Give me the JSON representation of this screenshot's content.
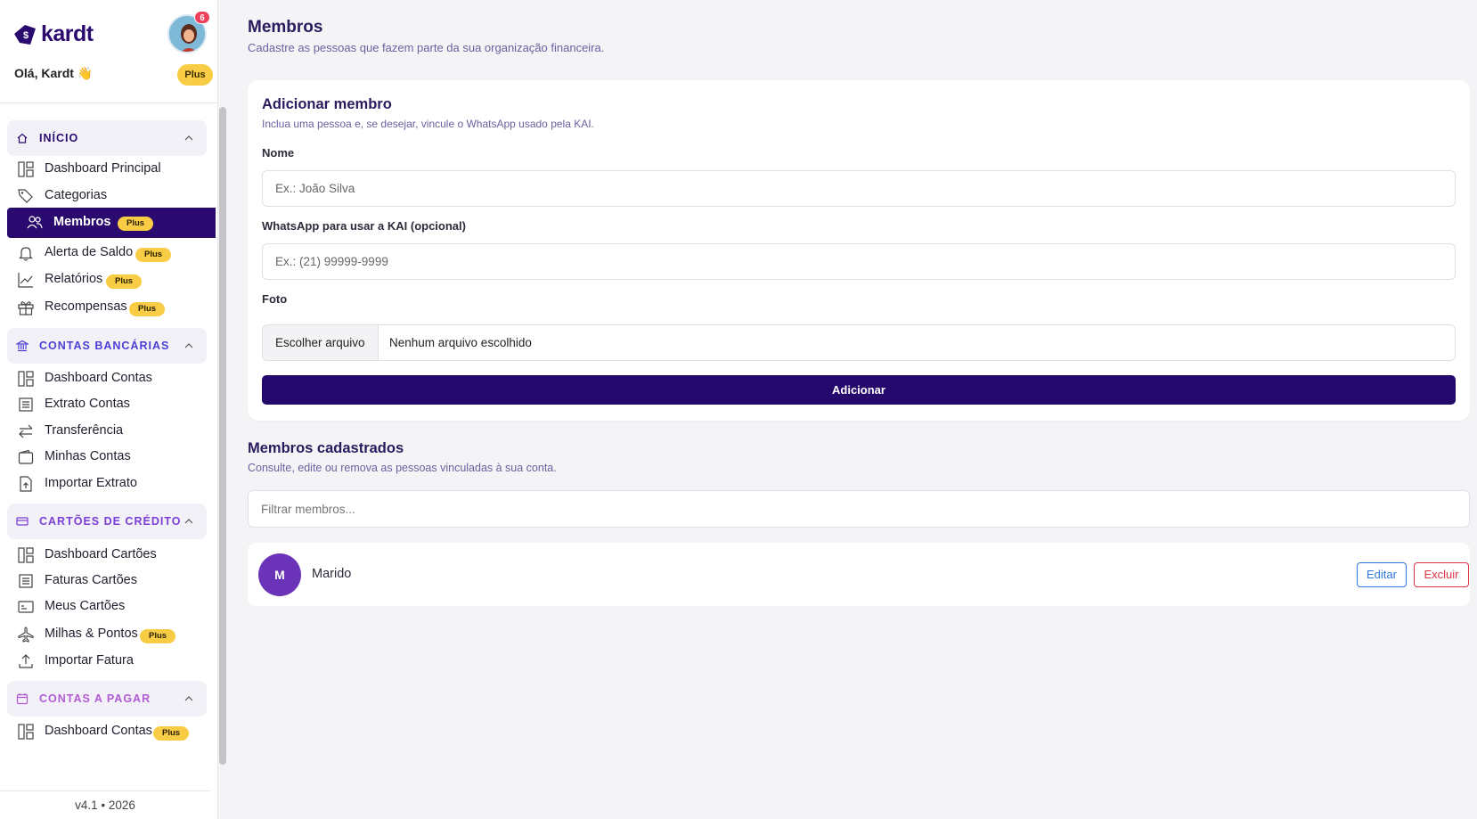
{
  "brand": {
    "name": "kardt",
    "accent": "#2a0a6f",
    "plus_color": "#f8cd45"
  },
  "header": {
    "greeting": "Olá, Kardt 👋",
    "notification_count": "6",
    "plan_badge": "Plus"
  },
  "sidebar": {
    "sections": [
      {
        "label": "INÍCIO",
        "icon": "home-icon",
        "color": "#2a0a6f",
        "items": [
          {
            "label": "Dashboard Principal",
            "icon": "dashboard-icon",
            "badge": ""
          },
          {
            "label": "Categorias",
            "icon": "tag-icon",
            "badge": ""
          },
          {
            "label": "Membros",
            "icon": "users-icon",
            "badge": "Plus",
            "active": true
          },
          {
            "label": "Alerta de Saldo",
            "icon": "bell-icon",
            "badge": "Plus"
          },
          {
            "label": "Relatórios",
            "icon": "chart-line-icon",
            "badge": "Plus"
          },
          {
            "label": "Recompensas",
            "icon": "gift-icon",
            "badge": "Plus"
          }
        ]
      },
      {
        "label": "CONTAS BANCÁRIAS",
        "icon": "bank-icon",
        "color": "#4b3fd6",
        "items": [
          {
            "label": "Dashboard Contas",
            "icon": "dashboard-icon",
            "badge": ""
          },
          {
            "label": "Extrato Contas",
            "icon": "statement-icon",
            "badge": ""
          },
          {
            "label": "Transferência",
            "icon": "transfer-icon",
            "badge": ""
          },
          {
            "label": "Minhas Contas",
            "icon": "wallet-icon",
            "badge": ""
          },
          {
            "label": "Importar Extrato",
            "icon": "file-upload-icon",
            "badge": ""
          }
        ]
      },
      {
        "label": "CARTÕES DE CRÉDITO",
        "icon": "credit-card-icon",
        "color": "#7a3ed6",
        "items": [
          {
            "label": "Dashboard Cartões",
            "icon": "dashboard-icon",
            "badge": ""
          },
          {
            "label": "Faturas Cartões",
            "icon": "statement-icon",
            "badge": ""
          },
          {
            "label": "Meus Cartões",
            "icon": "card-list-icon",
            "badge": ""
          },
          {
            "label": "Milhas & Pontos",
            "icon": "plane-icon",
            "badge": "Plus"
          },
          {
            "label": "Importar Fatura",
            "icon": "upload-icon",
            "badge": ""
          }
        ]
      },
      {
        "label": "CONTAS A PAGAR",
        "icon": "calendar-icon",
        "color": "#b25bd6",
        "items": [
          {
            "label": "Dashboard Contas",
            "icon": "dashboard-icon",
            "badge": "Plus"
          }
        ]
      }
    ],
    "version": "v4.1 • 2026"
  },
  "page": {
    "title": "Membros",
    "subtitle": "Cadastre as pessoas que fazem parte da sua organização financeira."
  },
  "form": {
    "title": "Adicionar membro",
    "subtitle": "Inclua uma pessoa e, se desejar, vincule o WhatsApp usado pela KAI.",
    "name_label": "Nome",
    "name_placeholder": "Ex.: João Silva",
    "whatsapp_label": "WhatsApp para usar a KAI (opcional)",
    "whatsapp_placeholder": "Ex.: (21) 99999-9999",
    "photo_label": "Foto",
    "file_button": "Escolher arquivo",
    "file_status": "Nenhum arquivo escolhido",
    "submit_label": "Adicionar"
  },
  "members": {
    "title": "Membros cadastrados",
    "subtitle": "Consulte, edite ou remova as pessoas vinculadas à sua conta.",
    "filter_placeholder": "Filtrar membros...",
    "list": [
      {
        "initial": "M",
        "name": "Marido",
        "edit_label": "Editar",
        "delete_label": "Excluir"
      }
    ]
  }
}
